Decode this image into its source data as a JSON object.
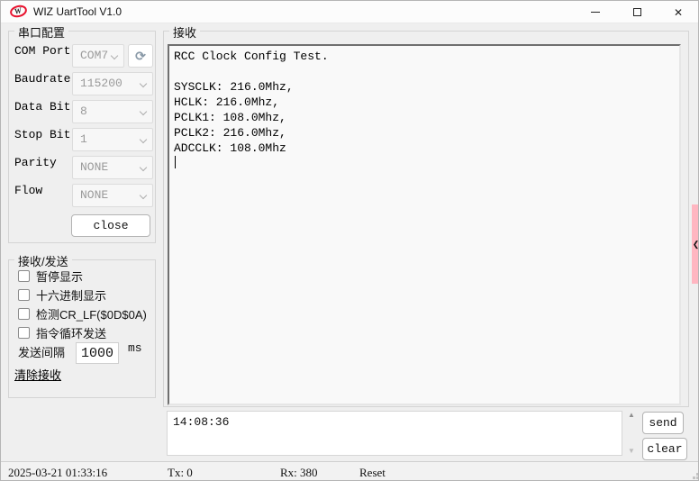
{
  "window": {
    "title": "WIZ UartTool V1.0",
    "logo_letter": "W"
  },
  "icons": {
    "close_window": "✕",
    "refresh": "⟳",
    "scroll_up": "▲",
    "scroll_down": "▼",
    "side_chevron": "❮"
  },
  "serial_config": {
    "title": "串口配置",
    "fields": [
      {
        "label": "COM Port",
        "value": "COM7"
      },
      {
        "label": "Baudrate",
        "value": "115200"
      },
      {
        "label": "Data Bit",
        "value": "8"
      },
      {
        "label": "Stop Bit",
        "value": "1"
      },
      {
        "label": "Parity",
        "value": "NONE"
      },
      {
        "label": "Flow",
        "value": "NONE"
      }
    ],
    "close_button": "close"
  },
  "rx_tx": {
    "title": "接收/发送",
    "checkboxes": [
      "暂停显示",
      "十六进制显示",
      "检测CR_LF($0D$0A)",
      "指令循环发送"
    ],
    "interval_label": "发送间隔",
    "interval_value": "1000",
    "interval_unit": "ms",
    "clear_receive_link": "清除接收"
  },
  "receive": {
    "title": "接收",
    "text": "RCC Clock Config Test.\n\nSYSCLK: 216.0Mhz,\nHCLK: 216.0Mhz,\nPCLK1: 108.0Mhz,\nPCLK2: 216.0Mhz,\nADCCLK: 108.0Mhz"
  },
  "send": {
    "input_value": "14:08:36",
    "send_button": "send",
    "clear_button": "clear"
  },
  "status_bar": {
    "timestamp": "2025-03-21 01:33:16",
    "tx": "Tx: 0",
    "rx": "Rx: 380",
    "reset": "Reset"
  },
  "colors": {
    "logo_red": "#e8112d",
    "side_tab_pink": "#ffb6c1"
  }
}
